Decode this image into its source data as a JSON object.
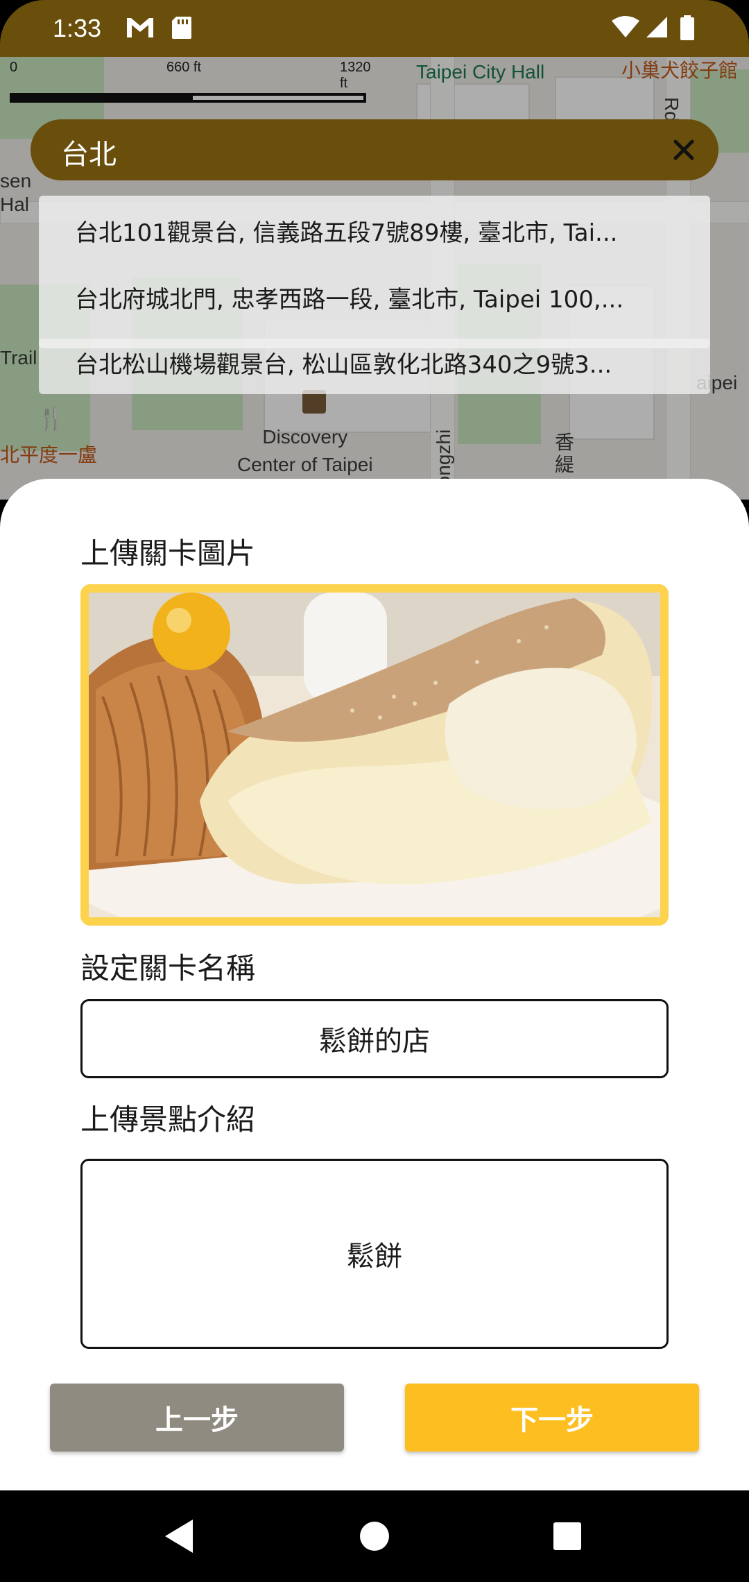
{
  "status_bar": {
    "time": "1:33",
    "icons": [
      "gmail-icon",
      "sd-card-icon",
      "wifi-icon",
      "signal-icon",
      "battery-icon"
    ]
  },
  "map": {
    "scale": {
      "labels": [
        "0",
        "660 ft",
        "1320 ft"
      ]
    },
    "labels": {
      "city_hall": "Taipei City Hall",
      "top_right": "小巢犬餃子館",
      "rd": "Rd",
      "sen_hal": "sen\nHal",
      "trail": "Trail",
      "aipei": "aipei",
      "restaurant": "北平度一盧",
      "discovery": "Discovery\nCenter of Taipei",
      "songzhi": "Songzhi",
      "xiangti": "香\n緹"
    }
  },
  "search": {
    "query": "台北"
  },
  "suggestions": [
    "台北101觀景台, 信義路五段7號89樓, 臺北市, Tai...",
    "台北府城北門, 忠孝西路一段, 臺北市, Taipei 100,...",
    "台北松山機場觀景台, 松山區敦化北路340之9號3..."
  ],
  "form": {
    "image_label": "上傳關卡圖片",
    "name_label": "設定關卡名稱",
    "name_value": "鬆餅的店",
    "intro_label": "上傳景點介紹",
    "intro_value": "鬆餅",
    "prev_button": "上一步",
    "next_button": "下一步"
  },
  "colors": {
    "brand_dark": "#6a4f0c",
    "accent_yellow": "#fdbe22",
    "image_border": "#fdd24d",
    "button_grey": "#8f8b80"
  }
}
